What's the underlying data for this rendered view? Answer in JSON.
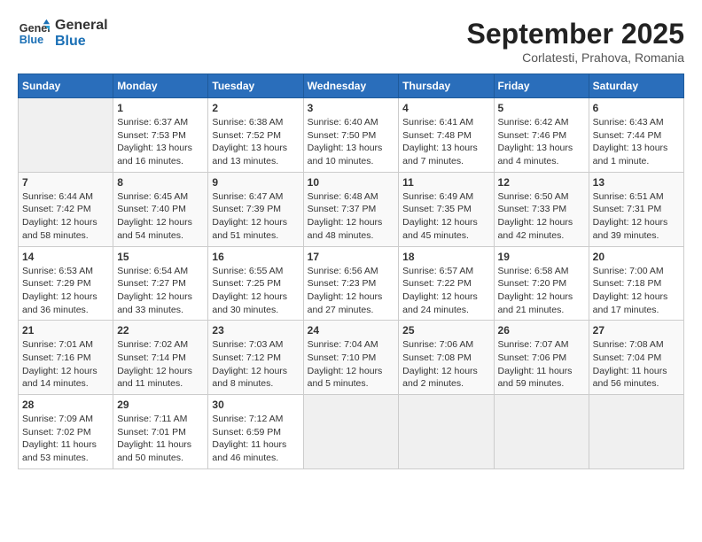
{
  "header": {
    "logo_line1": "General",
    "logo_line2": "Blue",
    "month_title": "September 2025",
    "subtitle": "Corlatesti, Prahova, Romania"
  },
  "days_of_week": [
    "Sunday",
    "Monday",
    "Tuesday",
    "Wednesday",
    "Thursday",
    "Friday",
    "Saturday"
  ],
  "weeks": [
    [
      {
        "day": "",
        "info": ""
      },
      {
        "day": "1",
        "info": "Sunrise: 6:37 AM\nSunset: 7:53 PM\nDaylight: 13 hours\nand 16 minutes."
      },
      {
        "day": "2",
        "info": "Sunrise: 6:38 AM\nSunset: 7:52 PM\nDaylight: 13 hours\nand 13 minutes."
      },
      {
        "day": "3",
        "info": "Sunrise: 6:40 AM\nSunset: 7:50 PM\nDaylight: 13 hours\nand 10 minutes."
      },
      {
        "day": "4",
        "info": "Sunrise: 6:41 AM\nSunset: 7:48 PM\nDaylight: 13 hours\nand 7 minutes."
      },
      {
        "day": "5",
        "info": "Sunrise: 6:42 AM\nSunset: 7:46 PM\nDaylight: 13 hours\nand 4 minutes."
      },
      {
        "day": "6",
        "info": "Sunrise: 6:43 AM\nSunset: 7:44 PM\nDaylight: 13 hours\nand 1 minute."
      }
    ],
    [
      {
        "day": "7",
        "info": "Sunrise: 6:44 AM\nSunset: 7:42 PM\nDaylight: 12 hours\nand 58 minutes."
      },
      {
        "day": "8",
        "info": "Sunrise: 6:45 AM\nSunset: 7:40 PM\nDaylight: 12 hours\nand 54 minutes."
      },
      {
        "day": "9",
        "info": "Sunrise: 6:47 AM\nSunset: 7:39 PM\nDaylight: 12 hours\nand 51 minutes."
      },
      {
        "day": "10",
        "info": "Sunrise: 6:48 AM\nSunset: 7:37 PM\nDaylight: 12 hours\nand 48 minutes."
      },
      {
        "day": "11",
        "info": "Sunrise: 6:49 AM\nSunset: 7:35 PM\nDaylight: 12 hours\nand 45 minutes."
      },
      {
        "day": "12",
        "info": "Sunrise: 6:50 AM\nSunset: 7:33 PM\nDaylight: 12 hours\nand 42 minutes."
      },
      {
        "day": "13",
        "info": "Sunrise: 6:51 AM\nSunset: 7:31 PM\nDaylight: 12 hours\nand 39 minutes."
      }
    ],
    [
      {
        "day": "14",
        "info": "Sunrise: 6:53 AM\nSunset: 7:29 PM\nDaylight: 12 hours\nand 36 minutes."
      },
      {
        "day": "15",
        "info": "Sunrise: 6:54 AM\nSunset: 7:27 PM\nDaylight: 12 hours\nand 33 minutes."
      },
      {
        "day": "16",
        "info": "Sunrise: 6:55 AM\nSunset: 7:25 PM\nDaylight: 12 hours\nand 30 minutes."
      },
      {
        "day": "17",
        "info": "Sunrise: 6:56 AM\nSunset: 7:23 PM\nDaylight: 12 hours\nand 27 minutes."
      },
      {
        "day": "18",
        "info": "Sunrise: 6:57 AM\nSunset: 7:22 PM\nDaylight: 12 hours\nand 24 minutes."
      },
      {
        "day": "19",
        "info": "Sunrise: 6:58 AM\nSunset: 7:20 PM\nDaylight: 12 hours\nand 21 minutes."
      },
      {
        "day": "20",
        "info": "Sunrise: 7:00 AM\nSunset: 7:18 PM\nDaylight: 12 hours\nand 17 minutes."
      }
    ],
    [
      {
        "day": "21",
        "info": "Sunrise: 7:01 AM\nSunset: 7:16 PM\nDaylight: 12 hours\nand 14 minutes."
      },
      {
        "day": "22",
        "info": "Sunrise: 7:02 AM\nSunset: 7:14 PM\nDaylight: 12 hours\nand 11 minutes."
      },
      {
        "day": "23",
        "info": "Sunrise: 7:03 AM\nSunset: 7:12 PM\nDaylight: 12 hours\nand 8 minutes."
      },
      {
        "day": "24",
        "info": "Sunrise: 7:04 AM\nSunset: 7:10 PM\nDaylight: 12 hours\nand 5 minutes."
      },
      {
        "day": "25",
        "info": "Sunrise: 7:06 AM\nSunset: 7:08 PM\nDaylight: 12 hours\nand 2 minutes."
      },
      {
        "day": "26",
        "info": "Sunrise: 7:07 AM\nSunset: 7:06 PM\nDaylight: 11 hours\nand 59 minutes."
      },
      {
        "day": "27",
        "info": "Sunrise: 7:08 AM\nSunset: 7:04 PM\nDaylight: 11 hours\nand 56 minutes."
      }
    ],
    [
      {
        "day": "28",
        "info": "Sunrise: 7:09 AM\nSunset: 7:02 PM\nDaylight: 11 hours\nand 53 minutes."
      },
      {
        "day": "29",
        "info": "Sunrise: 7:11 AM\nSunset: 7:01 PM\nDaylight: 11 hours\nand 50 minutes."
      },
      {
        "day": "30",
        "info": "Sunrise: 7:12 AM\nSunset: 6:59 PM\nDaylight: 11 hours\nand 46 minutes."
      },
      {
        "day": "",
        "info": ""
      },
      {
        "day": "",
        "info": ""
      },
      {
        "day": "",
        "info": ""
      },
      {
        "day": "",
        "info": ""
      }
    ]
  ]
}
